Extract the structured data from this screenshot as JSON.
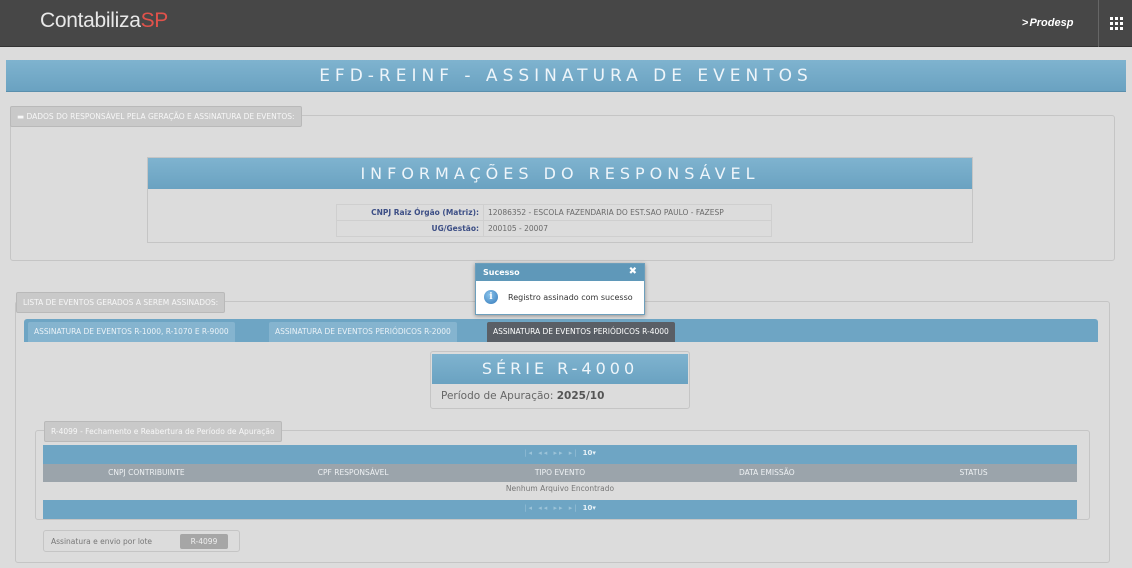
{
  "header": {
    "brand_main": "Contabiliza",
    "brand_accent": "SP",
    "partner": "Prodesp",
    "apps_icon": "grid-apps-icon"
  },
  "page": {
    "title": "EFD-REINF - ASSINATURA DE EVENTOS"
  },
  "responsavel": {
    "legend": "DADOS DO RESPONSÁVEL PELA GERAÇÃO E ASSINATURA DE EVENTOS:",
    "header": "INFORMAÇÕES DO RESPONSÁVEL",
    "rows": [
      {
        "label": "CNPJ Raiz Órgão (Matriz):",
        "value": "12086352 - ESCOLA FAZENDARIA DO EST.SAO PAULO - FAZESP"
      },
      {
        "label": "UG/Gestão:",
        "value": "200105 - 20007"
      }
    ]
  },
  "eventos": {
    "legend": "LISTA DE EVENTOS GERADOS A SEREM ASSINADOS:",
    "tabs": [
      "ASSINATURA DE EVENTOS R-1000, R-1070 E R-9000",
      "ASSINATURA DE EVENTOS PERIÓDICOS R-2000",
      "ASSINATURA DE EVENTOS PERIÓDICOS R-4000"
    ],
    "active_tab": 2,
    "serie_title": "SÉRIE R-4000",
    "periodo_label": "Período de Apuração:",
    "periodo_value": "2025/10"
  },
  "r4099": {
    "legend": "R-4099 - Fechamento e Reabertura de Período de Apuração",
    "pager": {
      "controls": "|◂  ◂◂     ▸▸  ▸|",
      "page_size": "10"
    },
    "columns": [
      "CNPJ CONTRIBUINTE",
      "CPF RESPONSÁVEL",
      "TIPO EVENTO",
      "DATA EMISSÃO",
      "STATUS"
    ],
    "empty_message": "Nenhum Arquivo Encontrado",
    "lote_label": "Assinatura e envio por lote",
    "lote_button": "R-4099"
  },
  "modal": {
    "title": "Sucesso",
    "close": "✖",
    "message": "Registro assinado com sucesso",
    "icon": "info-icon"
  },
  "colors": {
    "topbar": "#474747",
    "accent_blue": "#6ea5c4",
    "brand_accent": "#e0524b",
    "active_tab": "#5a5f66"
  }
}
